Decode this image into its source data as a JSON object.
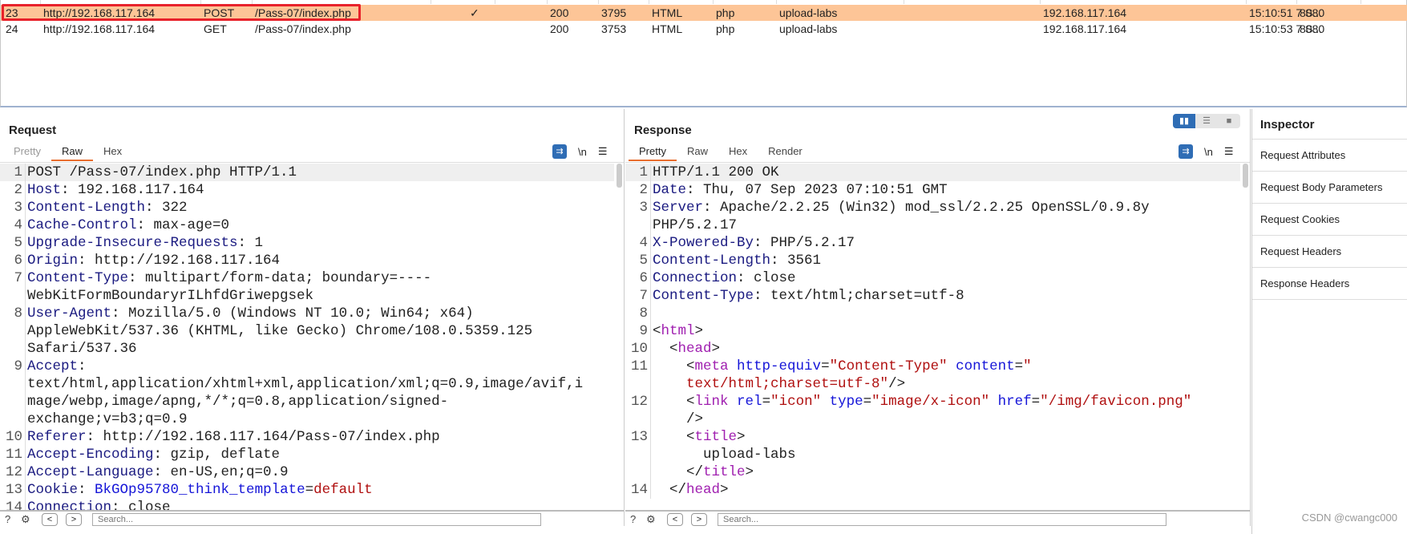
{
  "history": {
    "rows": [
      {
        "num": "23",
        "host": "http://192.168.117.164",
        "method": "POST",
        "url": "/Pass-07/index.php",
        "edited": "✓",
        "status": "200",
        "length": "3795",
        "mime": "HTML",
        "ext": "php",
        "title": "upload-labs",
        "ip": "192.168.117.164",
        "time": "15:10:51 7 S...",
        "port": "8080",
        "selected": true
      },
      {
        "num": "24",
        "host": "http://192.168.117.164",
        "method": "GET",
        "url": "/Pass-07/index.php",
        "edited": "",
        "status": "200",
        "length": "3753",
        "mime": "HTML",
        "ext": "php",
        "title": "upload-labs",
        "ip": "192.168.117.164",
        "time": "15:10:53 7 S...",
        "port": "8080",
        "selected": false
      }
    ]
  },
  "request": {
    "title": "Request",
    "tabs": [
      "Pretty",
      "Raw",
      "Hex"
    ],
    "active_tab": "Raw",
    "lines": [
      [
        [
          "p",
          "POST /Pass-07/index.php HTTP/1.1"
        ]
      ],
      [
        [
          "k",
          "Host"
        ],
        [
          "p",
          ": 192.168.117.164"
        ]
      ],
      [
        [
          "k",
          "Content-Length"
        ],
        [
          "p",
          ": 322"
        ]
      ],
      [
        [
          "k",
          "Cache-Control"
        ],
        [
          "p",
          ": max-age=0"
        ]
      ],
      [
        [
          "k",
          "Upgrade-Insecure-Requests"
        ],
        [
          "p",
          ": 1"
        ]
      ],
      [
        [
          "k",
          "Origin"
        ],
        [
          "p",
          ": http://192.168.117.164"
        ]
      ],
      [
        [
          "k",
          "Content-Type"
        ],
        [
          "p",
          ": multipart/form-data; boundary=----WebKitFormBoundaryrILhfdGriwepgsek"
        ]
      ],
      [
        [
          "k",
          "User-Agent"
        ],
        [
          "p",
          ": Mozilla/5.0 (Windows NT 10.0; Win64; x64) AppleWebKit/537.36 (KHTML, like Gecko) Chrome/108.0.5359.125 Safari/537.36"
        ]
      ],
      [
        [
          "k",
          "Accept"
        ],
        [
          "p",
          ": text/html,application/xhtml+xml,application/xml;q=0.9,image/avif,image/webp,image/apng,*/*;q=0.8,application/signed-exchange;v=b3;q=0.9"
        ]
      ],
      [
        [
          "k",
          "Referer"
        ],
        [
          "p",
          ": http://192.168.117.164/Pass-07/index.php"
        ]
      ],
      [
        [
          "k",
          "Accept-Encoding"
        ],
        [
          "p",
          ": gzip, deflate"
        ]
      ],
      [
        [
          "k",
          "Accept-Language"
        ],
        [
          "p",
          ": en-US,en;q=0.9"
        ]
      ],
      [
        [
          "k",
          "Cookie"
        ],
        [
          "p",
          ": "
        ],
        [
          "b",
          "BkGOp95780_think_template"
        ],
        [
          "p",
          "="
        ],
        [
          "v",
          "default"
        ]
      ],
      [
        [
          "k",
          "Connection"
        ],
        [
          "p",
          ": close"
        ]
      ]
    ],
    "search_placeholder": "Search..."
  },
  "response": {
    "title": "Response",
    "tabs": [
      "Pretty",
      "Raw",
      "Hex",
      "Render"
    ],
    "active_tab": "Pretty",
    "lines": [
      [
        [
          "p",
          "HTTP/1.1 200 OK"
        ]
      ],
      [
        [
          "k",
          "Date"
        ],
        [
          "p",
          ": Thu, 07 Sep 2023 07:10:51 GMT"
        ]
      ],
      [
        [
          "k",
          "Server"
        ],
        [
          "p",
          ": Apache/2.2.25 (Win32) mod_ssl/2.2.25 OpenSSL/0.9.8y PHP/5.2.17"
        ]
      ],
      [
        [
          "k",
          "X-Powered-By"
        ],
        [
          "p",
          ": PHP/5.2.17"
        ]
      ],
      [
        [
          "k",
          "Content-Length"
        ],
        [
          "p",
          ": 3561"
        ]
      ],
      [
        [
          "k",
          "Connection"
        ],
        [
          "p",
          ": close"
        ]
      ],
      [
        [
          "k",
          "Content-Type"
        ],
        [
          "p",
          ": text/html;charset=utf-8"
        ]
      ],
      [
        [
          "p",
          ""
        ]
      ],
      [
        [
          "p",
          "<"
        ],
        [
          "t",
          "html"
        ],
        [
          "p",
          ">"
        ]
      ],
      [
        [
          "p",
          "  <"
        ],
        [
          "t",
          "head"
        ],
        [
          "p",
          ">"
        ]
      ],
      [
        [
          "p",
          "    <"
        ],
        [
          "t",
          "meta "
        ],
        [
          "b",
          "http-equiv"
        ],
        [
          "p",
          "="
        ],
        [
          "v",
          "\"Content-Type\" "
        ],
        [
          "b",
          "content"
        ],
        [
          "p",
          "="
        ],
        [
          "v",
          "\"\n    text/html;charset=utf-8\""
        ],
        [
          "p",
          "/>"
        ]
      ],
      [
        [
          "p",
          "    <"
        ],
        [
          "t",
          "link "
        ],
        [
          "b",
          "rel"
        ],
        [
          "p",
          "="
        ],
        [
          "v",
          "\"icon\" "
        ],
        [
          "b",
          "type"
        ],
        [
          "p",
          "="
        ],
        [
          "v",
          "\"image/x-icon\" "
        ],
        [
          "b",
          "href"
        ],
        [
          "p",
          "="
        ],
        [
          "v",
          "\"/img/favicon.png\""
        ],
        [
          "p",
          "\n    />\n"
        ]
      ],
      [
        [
          "p",
          "    <"
        ],
        [
          "t",
          "title"
        ],
        [
          "p",
          ">\n      upload-labs\n    </"
        ],
        [
          "t",
          "title"
        ],
        [
          "p",
          ">"
        ]
      ],
      [
        [
          "p",
          "  </"
        ],
        [
          "t",
          "head"
        ],
        [
          "p",
          ">"
        ]
      ]
    ],
    "search_placeholder": "Search..."
  },
  "inspector": {
    "title": "Inspector",
    "items": [
      "Request Attributes",
      "Request Body Parameters",
      "Request Cookies",
      "Request Headers",
      "Response Headers"
    ]
  },
  "watermark": "CSDN @cwangc000"
}
